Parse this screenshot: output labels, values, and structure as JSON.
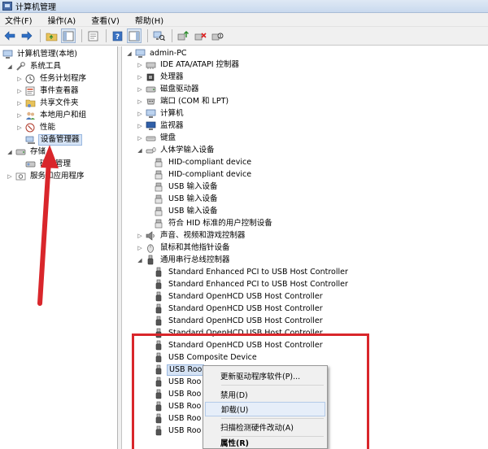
{
  "window": {
    "title": "计算机管理"
  },
  "menubar": {
    "items": [
      {
        "label": "文件(F)"
      },
      {
        "label": "操作(A)"
      },
      {
        "label": "查看(V)"
      },
      {
        "label": "帮助(H)"
      }
    ]
  },
  "left_tree": {
    "root": "计算机管理(本地)",
    "system_tools": "系统工具",
    "task_scheduler": "任务计划程序",
    "event_viewer": "事件查看器",
    "shared_folders": "共享文件夹",
    "local_users": "本地用户和组",
    "performance": "性能",
    "device_manager": "设备管理器",
    "storage": "存储",
    "disk_management": "磁盘管理",
    "services_apps": "服务和应用程序"
  },
  "device_tree": {
    "root": "admin-PC",
    "categories": {
      "ide": "IDE ATA/ATAPI 控制器",
      "cpu": "处理器",
      "disk": "磁盘驱动器",
      "ports": "端口 (COM 和 LPT)",
      "computer": "计算机",
      "monitor": "监视器",
      "keyboard": "键盘",
      "hid": "人体学输入设备",
      "sound": "声音、视频和游戏控制器",
      "mouse": "鼠标和其他指针设备",
      "usb": "通用串行总线控制器"
    },
    "hid_devices": [
      "HID-compliant device",
      "HID-compliant device",
      "USB 输入设备",
      "USB 输入设备",
      "USB 输入设备",
      "符合 HID 标准的用户控制设备"
    ],
    "usb_devices": [
      "Standard Enhanced PCI to USB Host Controller",
      "Standard Enhanced PCI to USB Host Controller",
      "Standard OpenHCD USB Host Controller",
      "Standard OpenHCD USB Host Controller",
      "Standard OpenHCD USB Host Controller",
      "Standard OpenHCD USB Host Controller",
      "Standard OpenHCD USB Host Controller",
      "USB Composite Device",
      "USB Roo",
      "USB Roo",
      "USB Roo",
      "USB Roo",
      "USB Roo",
      "USB Roo"
    ]
  },
  "context_menu": {
    "update_driver": "更新驱动程序软件(P)...",
    "disable": "禁用(D)",
    "uninstall": "卸载(U)",
    "scan": "扫描检测硬件改动(A)",
    "properties": "属性(R)"
  },
  "colors": {
    "annotation_red": "#d9262b",
    "selection": "#d5e3f5",
    "menu_hover": "#e6eef9"
  }
}
